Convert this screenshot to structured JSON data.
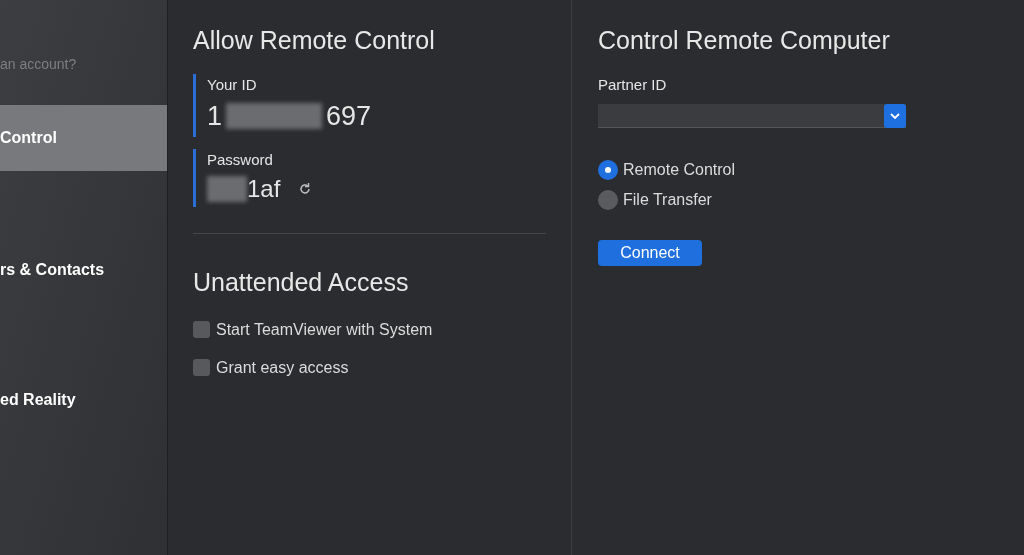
{
  "sidebar": {
    "account_prompt": "an account?",
    "items": [
      {
        "label": "Control",
        "selected": true
      },
      {
        "label": "rs & Contacts",
        "selected": false
      },
      {
        "label": "ed Reality",
        "selected": false
      }
    ]
  },
  "allow_remote_control": {
    "title": "Allow Remote Control",
    "your_id": {
      "label": "Your ID",
      "start": "1",
      "end": "697"
    },
    "password": {
      "label": "Password",
      "end": "1af"
    }
  },
  "unattended_access": {
    "title": "Unattended Access",
    "options": [
      {
        "label": "Start TeamViewer with System",
        "checked": false
      },
      {
        "label": "Grant easy access",
        "checked": false
      }
    ]
  },
  "control_remote_computer": {
    "title": "Control Remote Computer",
    "partner_id_label": "Partner ID",
    "modes": [
      {
        "label": "Remote Control",
        "selected": true
      },
      {
        "label": "File Transfer",
        "selected": false
      }
    ],
    "connect_button": "Connect"
  }
}
